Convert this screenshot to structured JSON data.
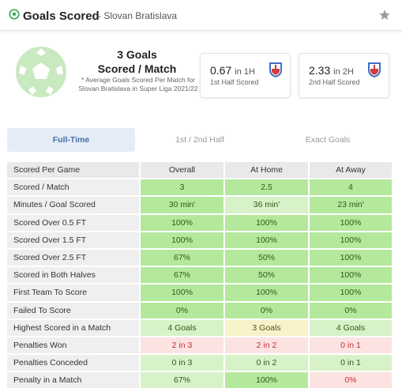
{
  "header": {
    "title": "Goals Scored",
    "subtitle": "- Slovan Bratislava"
  },
  "summary": {
    "avg_value": "3 Goals",
    "avg_label": "Scored / Match",
    "avg_note": "* Average Goals Scored Per Match for Slovan Bratislava in Super Liga 2021/22",
    "first_half": {
      "value": "0.67",
      "unit": "in 1H",
      "label": "1st Half Scored"
    },
    "second_half": {
      "value": "2.33",
      "unit": "in 2H",
      "label": "2nd Half Scored"
    }
  },
  "tabs": [
    {
      "label": "Full-Time",
      "active": true
    },
    {
      "label": "1st / 2nd Half",
      "active": false
    },
    {
      "label": "Exact Goals",
      "active": false
    }
  ],
  "table": {
    "headers": [
      "Scored Per Game",
      "Overall",
      "At Home",
      "At Away"
    ],
    "rows": [
      {
        "label": "Scored / Match",
        "values": [
          "3",
          "2.5",
          "4"
        ]
      },
      {
        "label": "Minutes / Goal Scored",
        "values": [
          "30 min'",
          "36 min'",
          "23 min'"
        ]
      },
      {
        "label": "Scored Over 0.5 FT",
        "values": [
          "100%",
          "100%",
          "100%"
        ]
      },
      {
        "label": "Scored Over 1.5 FT",
        "values": [
          "100%",
          "100%",
          "100%"
        ]
      },
      {
        "label": "Scored Over 2.5 FT",
        "values": [
          "67%",
          "50%",
          "100%"
        ]
      },
      {
        "label": "Scored in Both Halves",
        "values": [
          "67%",
          "50%",
          "100%"
        ]
      },
      {
        "label": "First Team To Score",
        "values": [
          "100%",
          "100%",
          "100%"
        ]
      },
      {
        "label": "Failed To Score",
        "values": [
          "0%",
          "0%",
          "0%"
        ]
      },
      {
        "label": "Highest Scored in a Match",
        "values": [
          "4 Goals",
          "3 Goals",
          "4 Goals"
        ]
      },
      {
        "label": "Penalties Won",
        "values": [
          "2 in 3",
          "2 in 2",
          "0 in 1"
        ]
      },
      {
        "label": "Penalties Conceded",
        "values": [
          "0 in 3",
          "0 in 2",
          "0 in 1"
        ]
      },
      {
        "label": "Penalty in a Match",
        "values": [
          "67%",
          "100%",
          "0%"
        ]
      }
    ]
  },
  "colors": {
    "green": "#b4e89c",
    "light_green": "#d7f2c8",
    "yellow": "#f7f2c9",
    "red": "#fde2e2",
    "tab_active": "#e3ecf7",
    "accent_blue": "#4a6fa5"
  }
}
